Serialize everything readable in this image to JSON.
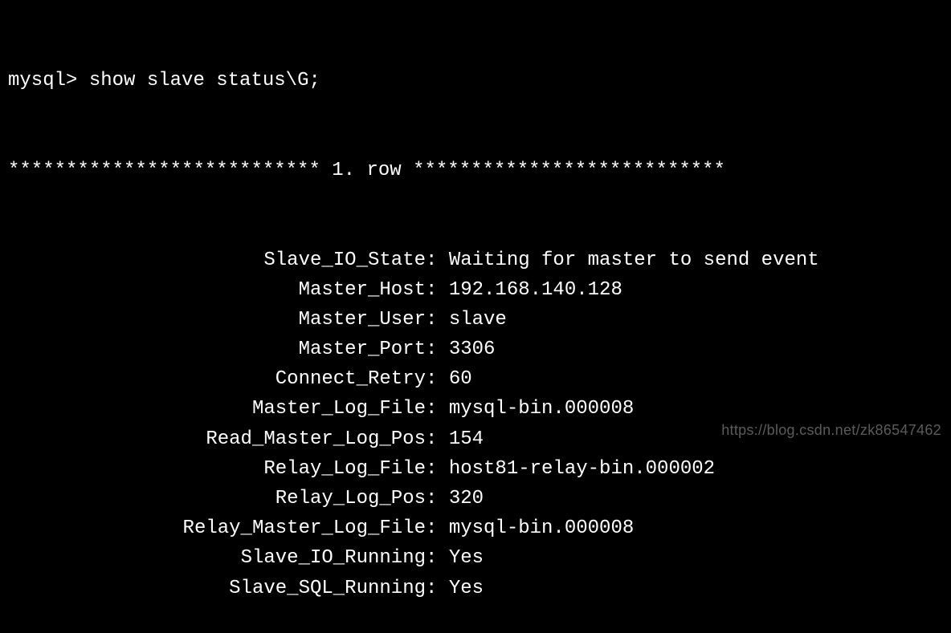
{
  "terminal": {
    "prompt": "mysql> ",
    "command": "show slave status\\G;",
    "row_header": {
      "stars_left": "*************************** ",
      "label": "1. row",
      "stars_right": " ***************************"
    },
    "fields": [
      {
        "key": "Slave_IO_State",
        "value": "Waiting for master to send event"
      },
      {
        "key": "Master_Host",
        "value": "192.168.140.128"
      },
      {
        "key": "Master_User",
        "value": "slave"
      },
      {
        "key": "Master_Port",
        "value": "3306"
      },
      {
        "key": "Connect_Retry",
        "value": "60"
      },
      {
        "key": "Master_Log_File",
        "value": "mysql-bin.000008"
      },
      {
        "key": "Read_Master_Log_Pos",
        "value": "154"
      },
      {
        "key": "Relay_Log_File",
        "value": "host81-relay-bin.000002"
      },
      {
        "key": "Relay_Log_Pos",
        "value": "320"
      },
      {
        "key": "Relay_Master_Log_File",
        "value": "mysql-bin.000008"
      },
      {
        "key": "Slave_IO_Running",
        "value": "Yes"
      },
      {
        "key": "Slave_SQL_Running",
        "value": "Yes"
      }
    ]
  },
  "watermark": "https://blog.csdn.net/zk86547462"
}
